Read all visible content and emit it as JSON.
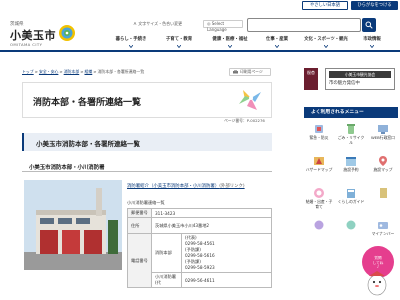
{
  "header": {
    "yasashii_label": "やさしい日本語",
    "hiragana_label": "ひらがなをつける",
    "prefecture": "茨城県",
    "city_name": "小美玉市",
    "city_roman": "OMITAMA CITY",
    "fontsize_label": "文字サイズ・色合い変更",
    "language_label": "Select Language"
  },
  "gnav": {
    "items": [
      "暮らし・手続き",
      "子育て・教育",
      "健康・医療・福祉",
      "仕事・産業",
      "文化・スポーツ・観光",
      "市政情報"
    ]
  },
  "breadcrumb": {
    "items": [
      "トップ",
      "安全・安心",
      "消防本部",
      "組織",
      "消防本部・各署所連絡一覧"
    ]
  },
  "print_label": "印刷用ページ",
  "page": {
    "title": "消防本部・各署所連絡一覧",
    "page_number": "ページ番号：P-002276",
    "section_heading": "小美玉市消防本部・各署所連絡一覧",
    "sub_heading": "小美玉市消防本部・小川消防署",
    "intro_link": "消防署紹介（小美玉市消防本部・小川消防署）",
    "intro_link_suffix": "(外部リンク)",
    "table_caption": "小川消防署連絡一覧",
    "table": {
      "postal_label": "郵便番号",
      "postal_value": "311-3423",
      "address_label": "住所",
      "address_value": "茨城県小美玉市小川43番地2",
      "phone_label": "電話番号",
      "dept_label": "消防本部",
      "phone_lines": [
        "(代表)",
        "0299-58-4561",
        "(予防課)",
        "0299-58-5616",
        "(予防課)",
        "0299-58-5923"
      ],
      "next_label": "小川消防署(代",
      "next_value": "0299-56-4611"
    }
  },
  "sidebar": {
    "banner_left": "桜杏",
    "banner_right_top": "小美玉市観光協会",
    "banner_right_bottom": "市の魅力発信中",
    "menu_title": "よく利用されるメニュー",
    "menu_items": [
      "緊急・防災",
      "ごみ・リサイクル",
      "WEB行政窓口",
      "ハザードマップ",
      "施設予約",
      "施設マップ",
      "結婚・出産・子育て",
      "くらしのガイド",
      "",
      "",
      "",
      "マイナンバー"
    ],
    "floater": "質問\nしてね\n♪"
  },
  "colors": {
    "brand": "#0a3a7a",
    "accent_pink": "#e53e8e"
  }
}
